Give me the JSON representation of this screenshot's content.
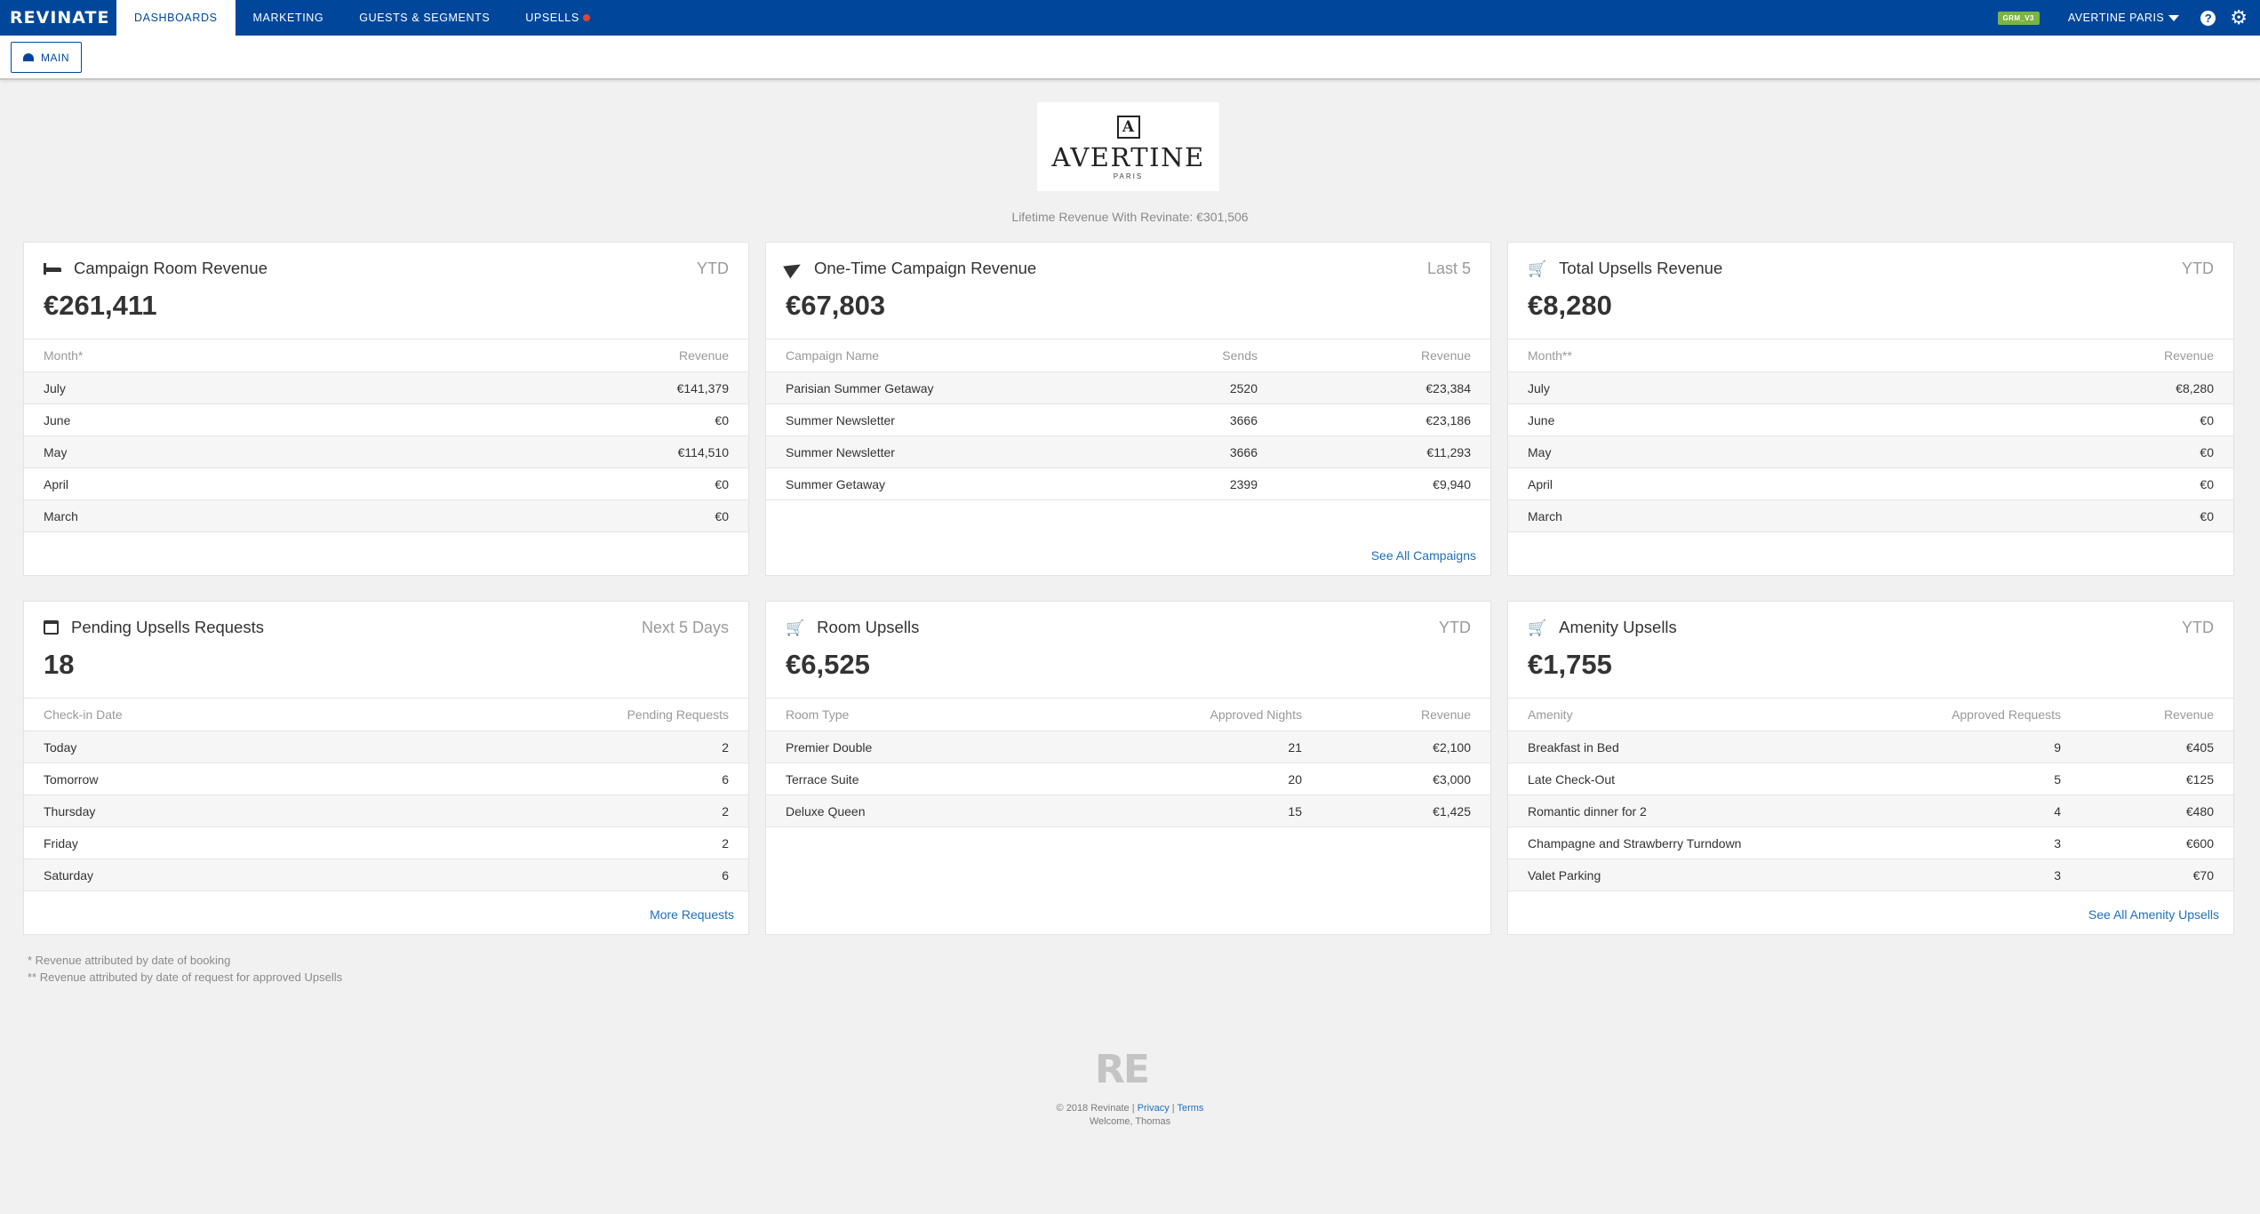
{
  "nav": {
    "brand": "REVINATE",
    "tabs": [
      "DASHBOARDS",
      "MARKETING",
      "GUESTS & SEGMENTS",
      "UPSELLS"
    ],
    "env_badge": "GRM_V3",
    "hotel": "AVERTINE PARIS",
    "help": "?"
  },
  "subnav": {
    "main_label": "MAIN"
  },
  "logo": {
    "mark": "A",
    "name": "AVERTINE",
    "sub": "PARIS"
  },
  "lifetime_revenue": "Lifetime Revenue With Revinate: €301,506",
  "cards": {
    "campaign_room": {
      "title": "Campaign Room Revenue",
      "period": "YTD",
      "value": "€261,411",
      "headers": [
        "Month*",
        "Revenue"
      ],
      "rows": [
        [
          "July",
          "€141,379"
        ],
        [
          "June",
          "€0"
        ],
        [
          "May",
          "€114,510"
        ],
        [
          "April",
          "€0"
        ],
        [
          "March",
          "€0"
        ]
      ]
    },
    "one_time": {
      "title": "One-Time Campaign Revenue",
      "period": "Last 5",
      "value": "€67,803",
      "headers": [
        "Campaign Name",
        "Sends",
        "Revenue"
      ],
      "rows": [
        [
          "Parisian Summer Getaway",
          "2520",
          "€23,384"
        ],
        [
          "Summer Newsletter",
          "3666",
          "€23,186"
        ],
        [
          "Summer Newsletter",
          "3666",
          "€11,293"
        ],
        [
          "Summer Getaway",
          "2399",
          "€9,940"
        ]
      ],
      "link": "See All Campaigns"
    },
    "total_upsells": {
      "title": "Total Upsells Revenue",
      "period": "YTD",
      "value": "€8,280",
      "headers": [
        "Month**",
        "Revenue"
      ],
      "rows": [
        [
          "July",
          "€8,280"
        ],
        [
          "June",
          "€0"
        ],
        [
          "May",
          "€0"
        ],
        [
          "April",
          "€0"
        ],
        [
          "March",
          "€0"
        ]
      ]
    },
    "pending": {
      "title": "Pending Upsells Requests",
      "period": "Next 5 Days",
      "value": "18",
      "headers": [
        "Check-in Date",
        "Pending Requests"
      ],
      "rows": [
        [
          "Today",
          "2"
        ],
        [
          "Tomorrow",
          "6"
        ],
        [
          "Thursday",
          "2"
        ],
        [
          "Friday",
          "2"
        ],
        [
          "Saturday",
          "6"
        ]
      ],
      "link": "More Requests"
    },
    "room_upsells": {
      "title": "Room Upsells",
      "period": "YTD",
      "value": "€6,525",
      "headers": [
        "Room Type",
        "Approved Nights",
        "Revenue"
      ],
      "rows": [
        [
          "Premier Double",
          "21",
          "€2,100"
        ],
        [
          "Terrace Suite",
          "20",
          "€3,000"
        ],
        [
          "Deluxe Queen",
          "15",
          "€1,425"
        ]
      ]
    },
    "amenity_upsells": {
      "title": "Amenity Upsells",
      "period": "YTD",
      "value": "€1,755",
      "headers": [
        "Amenity",
        "Approved Requests",
        "Revenue"
      ],
      "rows": [
        [
          "Breakfast in Bed",
          "9",
          "€405"
        ],
        [
          "Late Check-Out",
          "5",
          "€125"
        ],
        [
          "Romantic dinner for 2",
          "4",
          "€480"
        ],
        [
          "Champagne and Strawberry Turndown",
          "3",
          "€600"
        ],
        [
          "Valet Parking",
          "3",
          "€70"
        ]
      ],
      "link": "See All Amenity Upsells"
    }
  },
  "footnotes": [
    "* Revenue attributed by date of booking",
    "** Revenue attributed by date of request for approved Upsells"
  ],
  "footer": {
    "logo": "RE",
    "copyright": "© 2018 Revinate |",
    "privacy": "Privacy",
    "sep": "|",
    "terms": "Terms",
    "welcome": "Welcome, Thomas"
  }
}
